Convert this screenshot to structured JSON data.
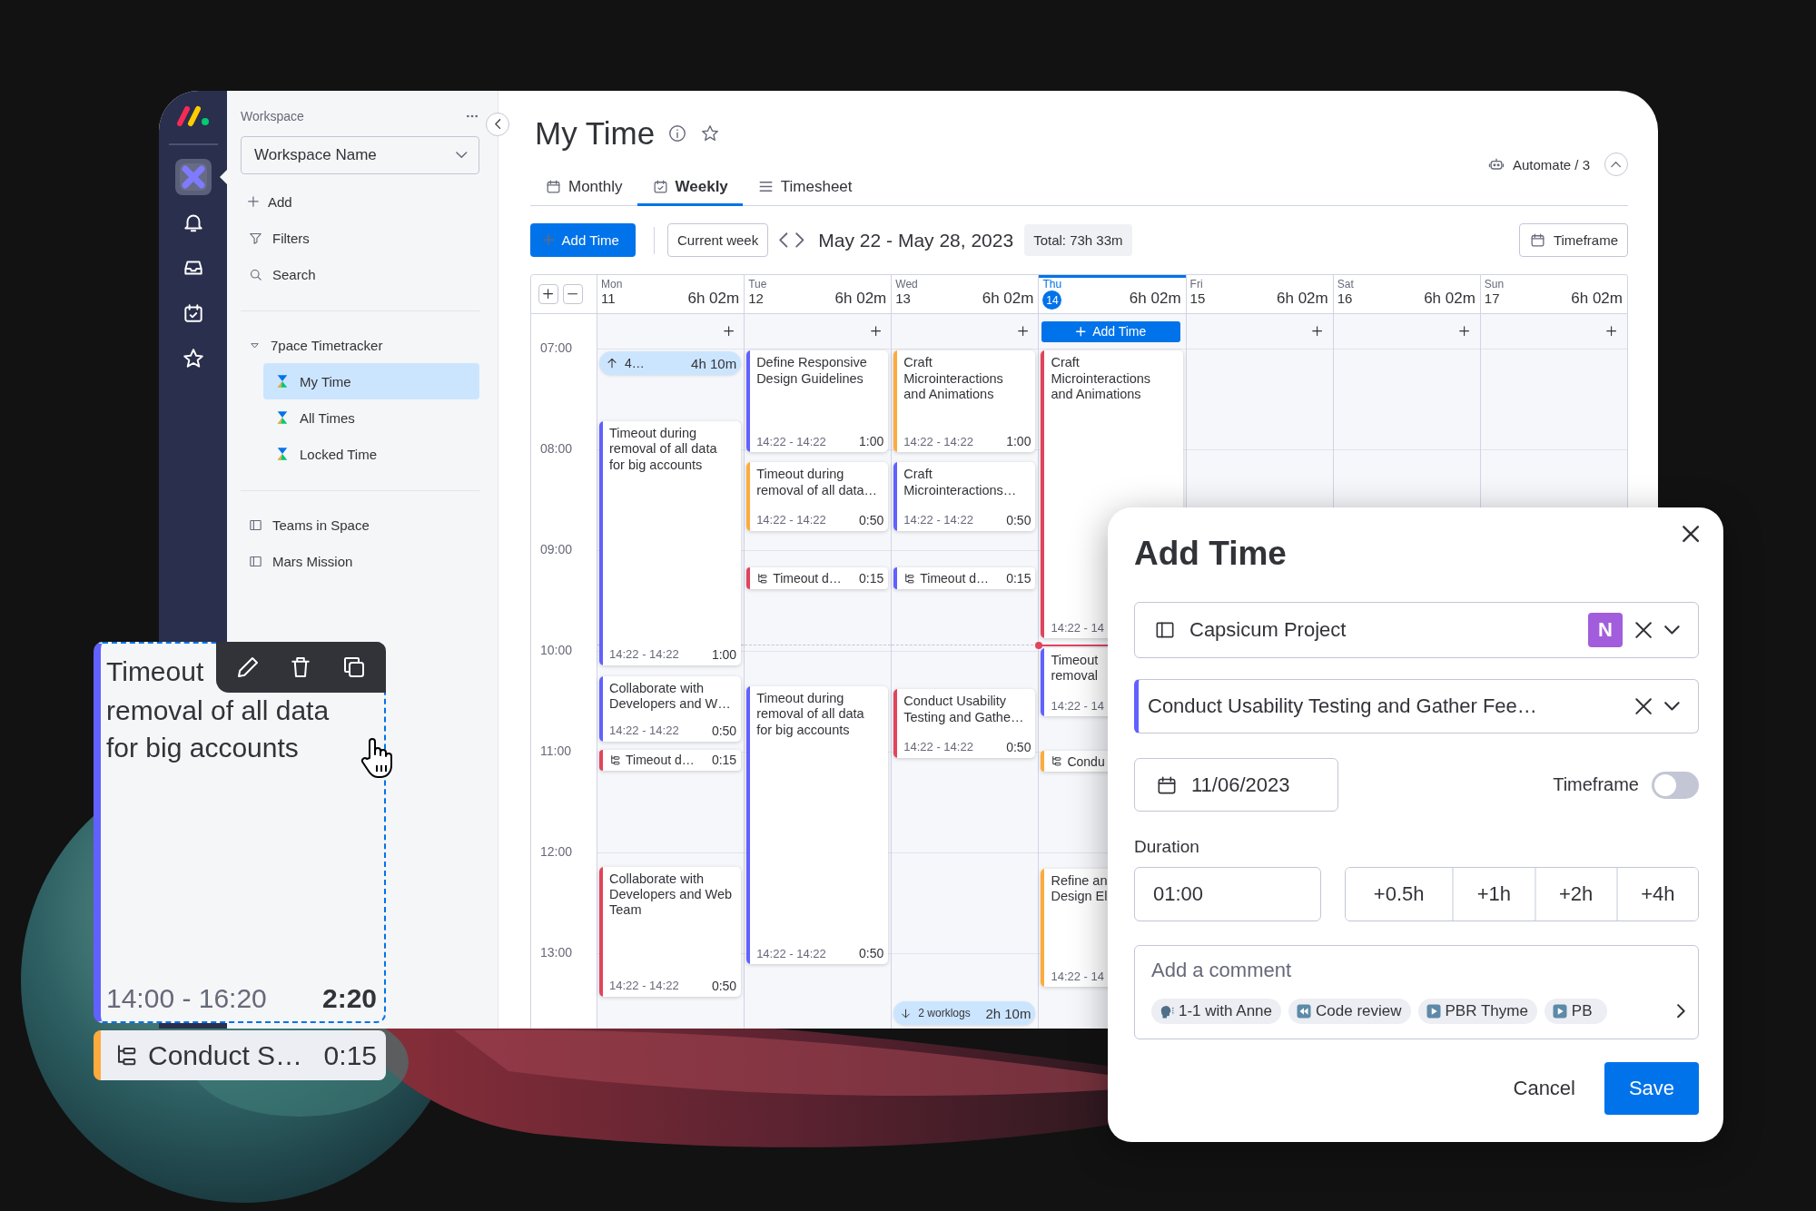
{
  "rail": {
    "items": [
      {
        "kind": "workspace",
        "selected": true
      },
      {
        "kind": "notifications",
        "selected": false
      },
      {
        "kind": "inbox",
        "selected": false
      },
      {
        "kind": "my-work",
        "selected": false
      },
      {
        "kind": "favorites",
        "selected": false
      }
    ]
  },
  "sidebar": {
    "heading": "Workspace",
    "workspace_select": {
      "value": "Workspace Name"
    },
    "actions": [
      {
        "kind": "add",
        "label": "Add"
      },
      {
        "kind": "filter",
        "label": "Filters"
      },
      {
        "kind": "search",
        "label": "Search"
      }
    ],
    "tree": [
      {
        "label": "7pace Timetracker",
        "expanded": true,
        "children": [
          {
            "label": "My Time",
            "selected": true
          },
          {
            "label": "All Times",
            "selected": false
          },
          {
            "label": "Locked Time",
            "selected": false
          }
        ]
      }
    ],
    "boards": [
      {
        "label": "Teams in Space"
      },
      {
        "label": "Mars Mission"
      }
    ]
  },
  "page": {
    "title": "My Time",
    "automate": "Automate / 3",
    "tabs": [
      {
        "kind": "calendar",
        "label": "Monthly",
        "selected": false
      },
      {
        "kind": "calendar-check",
        "label": "Weekly",
        "selected": true
      },
      {
        "kind": "list",
        "label": "Timesheet",
        "selected": false
      }
    ],
    "toolbar": {
      "add_button": "Add Time",
      "current_button": "Current week",
      "range": "May 22 - May 28, 2023",
      "total": "Total: 73h 33m",
      "timeframe_button": "Timeframe"
    }
  },
  "calendar": {
    "hours": [
      "07:00",
      "08:00",
      "09:00",
      "10:00",
      "11:00",
      "12:00",
      "13:00"
    ],
    "days": [
      {
        "weekday": "Mon",
        "date": "11",
        "total": "6h 02m",
        "today": false,
        "entries": [
          {
            "kind": "above",
            "label": "4…",
            "total": "4h 10m"
          },
          {
            "kind": "worklog",
            "title": "Timeout during removal of all data for big accounts",
            "time": "14:22 - 14:22",
            "duration": "1:00",
            "color": "#6161ff"
          },
          {
            "kind": "worklog",
            "title": "Collaborate with Developers and W…",
            "time": "14:22 - 14:22",
            "duration": "0:50",
            "color": "#6161ff"
          },
          {
            "kind": "subtask",
            "title": "Timeout d…",
            "duration": "0:15",
            "color": "#e2445c"
          },
          {
            "kind": "worklog",
            "title": "Collaborate with Developers and Web Team",
            "time": "14:22 - 14:22",
            "duration": "0:50",
            "color": "#e2445c"
          }
        ]
      },
      {
        "weekday": "Tue",
        "date": "12",
        "total": "6h 02m",
        "today": false,
        "entries": [
          {
            "kind": "worklog",
            "title": "Define Responsive Design Guidelines",
            "time": "14:22 - 14:22",
            "duration": "1:00",
            "color": "#6161ff"
          },
          {
            "kind": "worklog",
            "title": "Timeout during removal of all data…",
            "time": "14:22 - 14:22",
            "duration": "0:50",
            "color": "#fdab3d"
          },
          {
            "kind": "subtask",
            "title": "Timeout d…",
            "duration": "0:15",
            "color": "#e2445c"
          },
          {
            "kind": "worklog",
            "title": "Timeout during removal of all data for big accounts",
            "time": "14:22 - 14:22",
            "duration": "0:50",
            "color": "#6161ff"
          }
        ]
      },
      {
        "weekday": "Wed",
        "date": "13",
        "total": "6h 02m",
        "today": false,
        "entries": [
          {
            "kind": "worklog",
            "title": "Craft Microinteractions and Animations",
            "time": "14:22 - 14:22",
            "duration": "1:00",
            "color": "#fdab3d"
          },
          {
            "kind": "worklog",
            "title": "Craft Microinteractions…",
            "time": "14:22 - 14:22",
            "duration": "0:50",
            "color": "#6161ff"
          },
          {
            "kind": "subtask",
            "title": "Timeout d…",
            "duration": "0:15",
            "color": "#6161ff"
          },
          {
            "kind": "worklog",
            "title": "Conduct Usability Testing and Gathe…",
            "time": "14:22 - 14:22",
            "duration": "0:50",
            "color": "#e2445c"
          },
          {
            "kind": "below",
            "label": "2 worklogs",
            "total": "2h 10m"
          }
        ]
      },
      {
        "weekday": "Thu",
        "date": "14",
        "total": "6h 02m",
        "today": true,
        "add_button": "Add Time",
        "entries": [
          {
            "kind": "worklog",
            "title": "Craft Microinteractions and Animations",
            "time": "14:22 - 14",
            "color": "#e2445c"
          },
          {
            "kind": "worklog",
            "title": "Timeout\nremoval",
            "time": "14:22 - 14",
            "color": "#6161ff"
          },
          {
            "kind": "subtask",
            "title": "Condu",
            "color": "#fdab3d"
          },
          {
            "kind": "worklog",
            "title": "Refine an\nDesign El",
            "time": "14:22 - 14",
            "color": "#fdab3d"
          }
        ]
      },
      {
        "weekday": "Fri",
        "date": "15",
        "total": "6h 02m",
        "today": false
      },
      {
        "weekday": "Sat",
        "date": "16",
        "total": "6h 02m",
        "today": false
      },
      {
        "weekday": "Sun",
        "date": "17",
        "total": "6h 02m",
        "today": false
      }
    ]
  },
  "dialog": {
    "title": "Add Time",
    "project": {
      "value": "Capsicum Project",
      "badge": "N"
    },
    "task": {
      "value": "Conduct Usability Testing and Gather Fee…"
    },
    "date": "11/06/2023",
    "timeframe": {
      "label": "Timeframe",
      "on": false
    },
    "duration_label": "Duration",
    "duration": "01:00",
    "increments": [
      "+0.5h",
      "+1h",
      "+2h",
      "+4h"
    ],
    "comment": {
      "placeholder": "Add a comment",
      "suggestions": [
        {
          "kind": "speech",
          "label": "1-1 with Anne"
        },
        {
          "kind": "rewind",
          "label": "Code review"
        },
        {
          "kind": "play",
          "label": "PBR Thyme"
        },
        {
          "kind": "play",
          "label": "PB"
        }
      ]
    },
    "cancel": "Cancel",
    "save": "Save"
  },
  "drag_card": {
    "title_start": "Timeout",
    "title_end": "removal of all data for big accounts",
    "time": "14:00 - 16:20",
    "duration": "2:20",
    "subtask": {
      "title": "Conduct S…",
      "duration": "0:15"
    }
  }
}
